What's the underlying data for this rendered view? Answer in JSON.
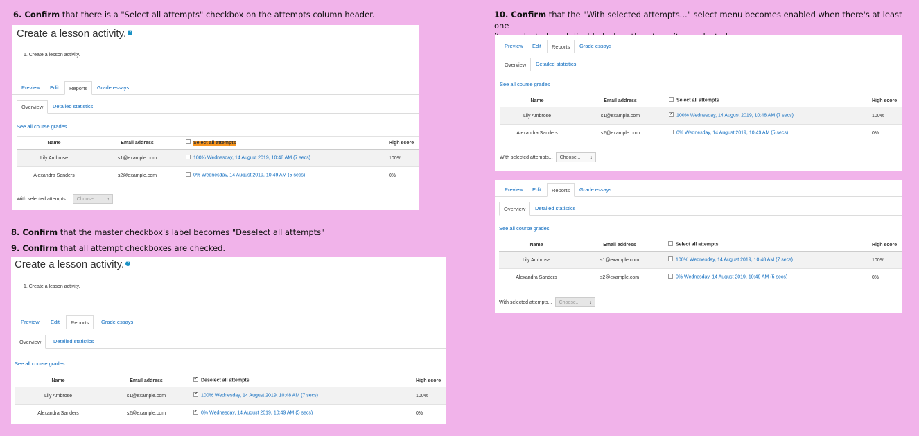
{
  "notes": {
    "n6_num": "6. Confirm",
    "n6_text": " that there  is a \"Select all attempts\" checkbox on the attempts  column header.",
    "n8_num": "8. Confirm",
    "n8_text": " that the master checkbox's label becomes \"Deselect all attempts\"",
    "n9_num": "9. Confirm",
    "n9_text": " that all attempt checkboxes are checked.",
    "n10_num": "10. Confirm",
    "n10_line1": " that the \"With selected attempts...\"  select menu  becomes enabled when  there's at least one",
    "n10_line2": "item selected, and disabled when there's no item selected."
  },
  "page": {
    "title": "Create a lesson activity.",
    "help_icon": "?",
    "intro_item": "1. Create a lesson activity."
  },
  "tabs": {
    "preview": "Preview",
    "edit": "Edit",
    "reports": "Reports",
    "grade_essays": "Grade essays"
  },
  "subtabs": {
    "overview": "Overview",
    "detailed": "Detailed statistics"
  },
  "links": {
    "see_all": "See all course grades"
  },
  "table": {
    "col_name": "Name",
    "col_email": "Email address",
    "col_select_all": "Select all attempts",
    "col_deselect_all": "Deselect all attempts",
    "col_high": "High score",
    "rows": [
      {
        "name": "Lily Ambrose",
        "email": "s1@example.com",
        "attempt": "100% Wednesday, 14 August 2019, 10:48 AM (7 secs)",
        "high": "100%"
      },
      {
        "name": "Alexandra Sanders",
        "email": "s2@example.com",
        "attempt": "0% Wednesday, 14 August 2019, 10:49 AM (5 secs)",
        "high": "0%"
      }
    ]
  },
  "with_selected": {
    "label": "With selected attempts...",
    "placeholder": "Choose..."
  },
  "checkmark": "✔",
  "colors": {
    "background": "#f1b3ea",
    "link": "#0f6cbf",
    "highlight": "#f7941d"
  }
}
